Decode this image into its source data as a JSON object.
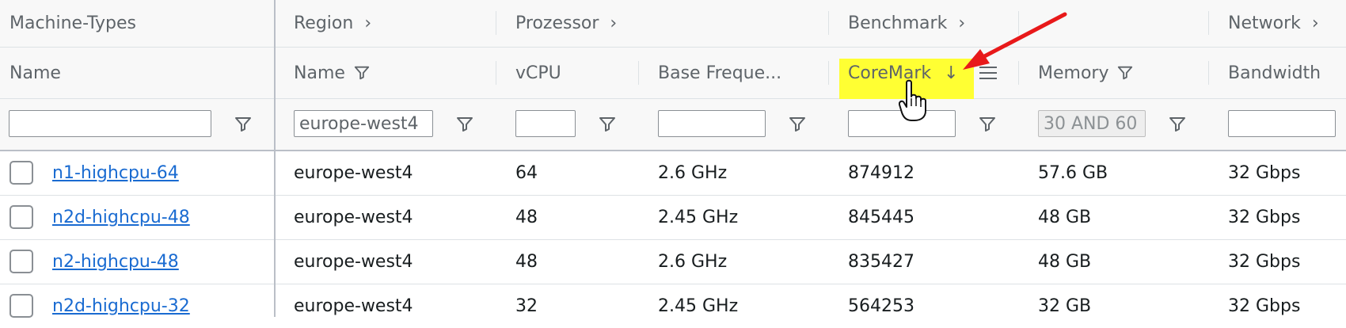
{
  "groups": {
    "machine_types": "Machine-Types",
    "region": "Region",
    "processor": "Prozessor",
    "benchmark": "Benchmark",
    "network": "Network"
  },
  "columns": {
    "name": "Name",
    "region_name": "Name",
    "vcpu": "vCPU",
    "base_frequency": "Base Freque...",
    "coremark": "CoreMark",
    "coremark_sort": "↓",
    "memory": "Memory",
    "bandwidth": "Bandwidth"
  },
  "filters": {
    "name": "",
    "region": "europe-west4",
    "vcpu": "",
    "base_frequency": "",
    "coremark": "",
    "memory": "30 AND 60",
    "bandwidth": ""
  },
  "rows": [
    {
      "name": "n1-highcpu-64",
      "region": "europe-west4",
      "vcpu": "64",
      "freq": "2.6 GHz",
      "coremark": "874912",
      "memory": "57.6 GB",
      "bandwidth": "32 Gbps"
    },
    {
      "name": "n2d-highcpu-48",
      "region": "europe-west4",
      "vcpu": "48",
      "freq": "2.45 GHz",
      "coremark": "845445",
      "memory": "48 GB",
      "bandwidth": "32 Gbps"
    },
    {
      "name": "n2-highcpu-48",
      "region": "europe-west4",
      "vcpu": "48",
      "freq": "2.6 GHz",
      "coremark": "835427",
      "memory": "48 GB",
      "bandwidth": "32 Gbps"
    },
    {
      "name": "n2d-highcpu-32",
      "region": "europe-west4",
      "vcpu": "32",
      "freq": "2.45 GHz",
      "coremark": "564253",
      "memory": "32 GB",
      "bandwidth": "32 Gbps"
    }
  ],
  "colors": {
    "highlight": "#ffff33",
    "arrow": "#e8191a",
    "link": "#1a6bd1"
  }
}
